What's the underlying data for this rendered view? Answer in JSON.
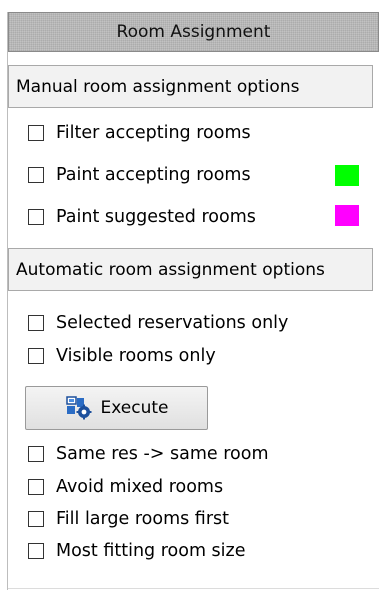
{
  "title": "Room Assignment",
  "manual": {
    "header": "Manual room assignment options",
    "filter_label": "Filter accepting rooms",
    "paint_accepting_label": "Paint accepting rooms",
    "paint_suggested_label": "Paint suggested rooms",
    "accepting_color": "#00ff00",
    "suggested_color": "#ff00ff"
  },
  "automatic": {
    "header": "Automatic room assignment options",
    "selected_label": "Selected reservations only",
    "visible_label": "Visible rooms only",
    "execute_label": "Execute",
    "execute_icon": "room-assign-icon",
    "same_res_label": "Same res -> same room",
    "avoid_mixed_label": "Avoid mixed rooms",
    "fill_large_label": "Fill large rooms first",
    "most_fitting_label": "Most fitting room size"
  }
}
